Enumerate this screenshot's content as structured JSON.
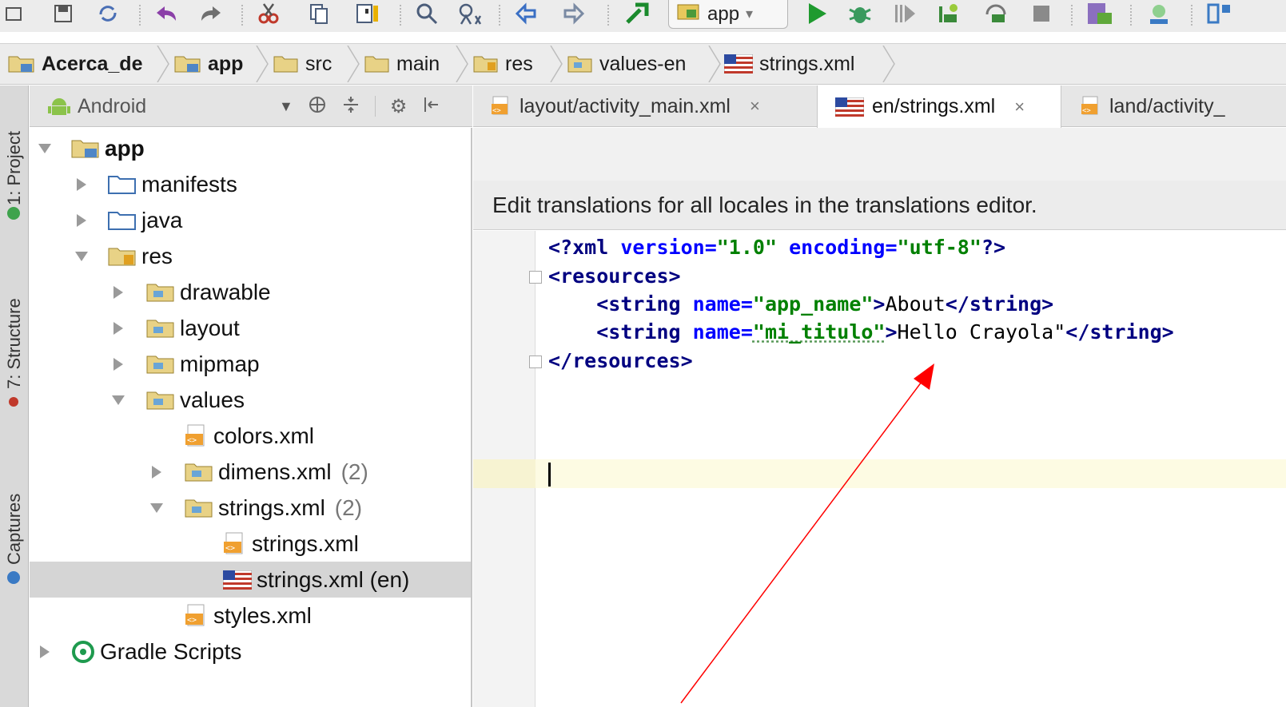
{
  "toolbar": {
    "run_config": "app",
    "icons": [
      "open-folder-icon",
      "save-icon",
      "sync-icon",
      "undo-icon",
      "redo-icon",
      "cut-icon",
      "copy-icon",
      "paste-icon",
      "search-icon",
      "replace-icon",
      "back-icon",
      "forward-icon",
      "build-icon",
      "run-config-icon",
      "run-icon",
      "debug-icon",
      "attach-debugger-icon",
      "apply-changes-icon",
      "profile-icon",
      "stop-icon",
      "avd-manager-icon",
      "sdk-manager-icon",
      "layout-inspector-icon"
    ]
  },
  "breadcrumb": [
    {
      "label": "Acerca_de",
      "icon": "module-folder-icon"
    },
    {
      "label": "app",
      "icon": "module-folder-icon"
    },
    {
      "label": "src",
      "icon": "folder-icon"
    },
    {
      "label": "main",
      "icon": "folder-icon"
    },
    {
      "label": "res",
      "icon": "resource-folder-icon"
    },
    {
      "label": "values-en",
      "icon": "resource-dir-icon"
    },
    {
      "label": "strings.xml",
      "icon": "us-flag-icon"
    }
  ],
  "side_tool_windows": [
    "1: Project",
    "7: Structure",
    "Captures"
  ],
  "project_panel": {
    "view_mode": "Android",
    "tree": [
      {
        "label": "app",
        "level": 0,
        "expanded": true,
        "bold": true
      },
      {
        "label": "manifests",
        "level": 1,
        "expanded": false
      },
      {
        "label": "java",
        "level": 1,
        "expanded": false
      },
      {
        "label": "res",
        "level": 1,
        "expanded": true
      },
      {
        "label": "drawable",
        "level": 2,
        "expanded": false
      },
      {
        "label": "layout",
        "level": 2,
        "expanded": false
      },
      {
        "label": "mipmap",
        "level": 2,
        "expanded": false
      },
      {
        "label": "values",
        "level": 2,
        "expanded": true
      },
      {
        "label": "colors.xml",
        "level": 3,
        "leaf": true
      },
      {
        "label": "dimens.xml",
        "count": "(2)",
        "level": 3,
        "expanded": false
      },
      {
        "label": "strings.xml",
        "count": "(2)",
        "level": 3,
        "expanded": true
      },
      {
        "label": "strings.xml",
        "level": 4,
        "leaf": true
      },
      {
        "label": "strings.xml (en)",
        "level": 4,
        "leaf": true,
        "selected": true,
        "flag": true
      },
      {
        "label": "styles.xml",
        "level": 3,
        "leaf": true
      },
      {
        "label": "Gradle Scripts",
        "level": 0,
        "expanded": false,
        "gradle": true
      }
    ]
  },
  "editor": {
    "tabs": [
      {
        "label": "layout/activity_main.xml",
        "close": "×",
        "active": false
      },
      {
        "label": "en/strings.xml",
        "close": "×",
        "active": true
      },
      {
        "label": "land/activity_",
        "close": "",
        "active": false
      }
    ],
    "notice": "Edit translations for all locales in the translations editor.",
    "lines": {
      "l1": {
        "pi_open": "<?",
        "xml": "xml",
        "a1": " version",
        "eq1": "=",
        "v1": "\"1.0\"",
        "a2": " encoding",
        "eq2": "=",
        "v2": "\"utf-8\"",
        "pi_close": "?>"
      },
      "l2": {
        "tag": "<resources>"
      },
      "l3": {
        "indent": "    ",
        "open": "<string",
        "attr": " name",
        "eq": "=",
        "val": "\"app_name\"",
        "gt": ">",
        "text": "About",
        "close": "</string>"
      },
      "l4": {
        "indent": "    ",
        "open": "<string",
        "attr": " name",
        "eq": "=",
        "val": "\"mi_titulo\"",
        "gt": ">",
        "text": "Hello Crayola\"",
        "close": "</string>"
      },
      "l5": {
        "tag": "</resources>"
      }
    }
  },
  "colors": {
    "annotation_arrow": "#ff0000",
    "selection": "#d5d5d5",
    "current_line": "#fdfbe3"
  }
}
